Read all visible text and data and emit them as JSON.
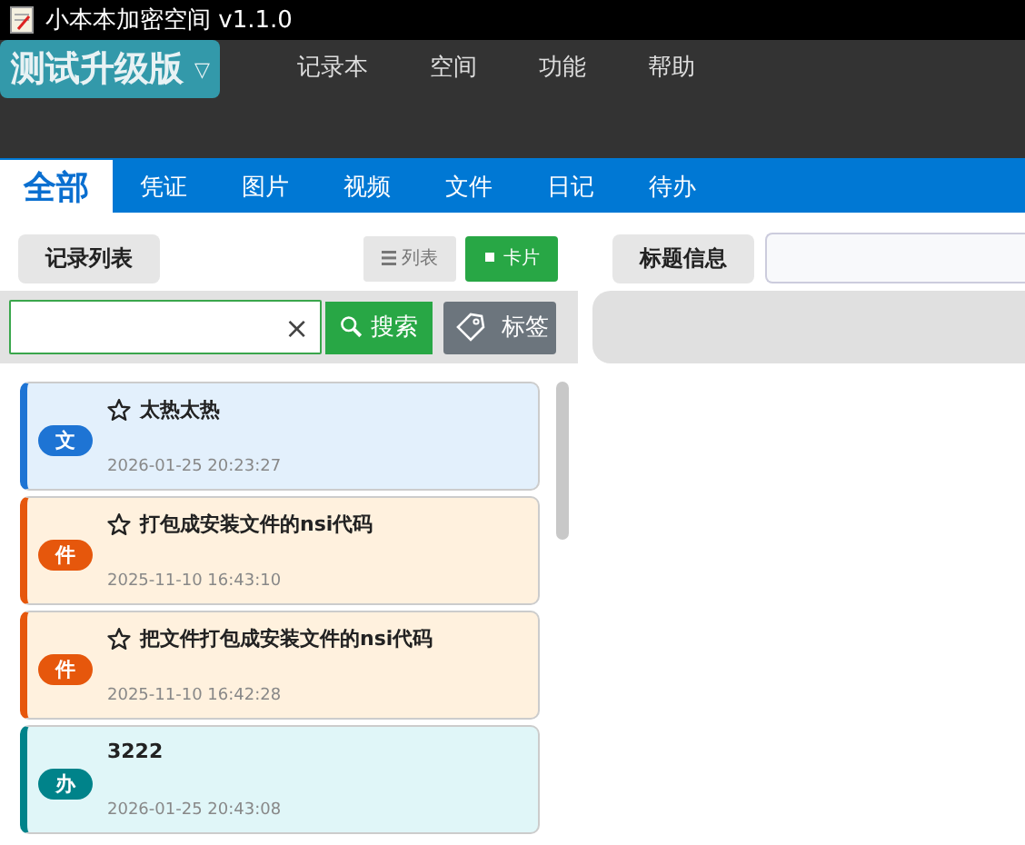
{
  "window": {
    "title": "小本本加密空间 v1.1.0"
  },
  "space_selector": {
    "label": "测试升级版",
    "caret": "▽"
  },
  "menu": [
    "记录本",
    "空间",
    "功能",
    "帮助"
  ],
  "tabs": [
    {
      "label": "全部",
      "selected": true
    },
    {
      "label": "凭证",
      "selected": false
    },
    {
      "label": "图片",
      "selected": false
    },
    {
      "label": "视频",
      "selected": false
    },
    {
      "label": "文件",
      "selected": false
    },
    {
      "label": "日记",
      "selected": false
    },
    {
      "label": "待办",
      "selected": false
    }
  ],
  "list_header": {
    "title": "记录列表",
    "views": [
      {
        "label": "列表",
        "selected": false
      },
      {
        "label": "卡片",
        "selected": true
      }
    ]
  },
  "search": {
    "clear": "×",
    "button": "搜索",
    "tag_button": "标签"
  },
  "records": [
    {
      "kind": "text",
      "badge": "文",
      "color": "#1e74d4",
      "starred": true,
      "title": "太热太热",
      "time": "2026-01-25 20:23:27"
    },
    {
      "kind": "file",
      "badge": "件",
      "color": "#e6570c",
      "starred": true,
      "title": "打包成安装文件的nsi代码",
      "time": "2025-11-10 16:43:10"
    },
    {
      "kind": "file",
      "badge": "件",
      "color": "#e6570c",
      "starred": true,
      "title": "把文件打包成安装文件的nsi代码",
      "time": "2025-11-10 16:42:28"
    },
    {
      "kind": "todo",
      "badge": "办",
      "color": "#00838a",
      "starred": false,
      "title": "3222",
      "time": "2026-01-25 20:43:08"
    }
  ],
  "detail": {
    "title_label": "标题信息"
  }
}
